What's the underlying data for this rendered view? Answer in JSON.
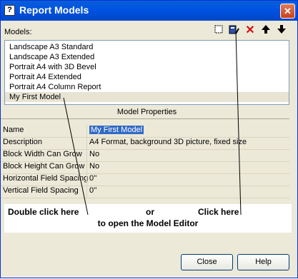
{
  "window": {
    "title": "Report Models",
    "title_icon": "?",
    "close_glyph": "✕"
  },
  "models": {
    "label": "Models:",
    "items": [
      {
        "label": "Landscape A3 Standard"
      },
      {
        "label": "Landscape A3 Extended"
      },
      {
        "label": "Portrait A4 with 3D Bevel"
      },
      {
        "label": "Portrait A4 Extended"
      },
      {
        "label": "Portrait A4 Column Report"
      },
      {
        "label": "My First Model",
        "selected": true
      }
    ]
  },
  "toolbar": {
    "new_icon": "new-icon",
    "edit_icon": "edit-model-icon",
    "delete_icon": "delete-icon",
    "up_icon": "arrow-up-icon",
    "down_icon": "arrow-down-icon"
  },
  "properties": {
    "header": "Model Properties",
    "rows": [
      {
        "name": "Name",
        "value": "My First Model"
      },
      {
        "name": "Description",
        "value": "A4 Format, background 3D picture, fixed size"
      },
      {
        "name": "Block Width Can Grow",
        "value": "No"
      },
      {
        "name": "Block Height Can Grow",
        "value": "No"
      },
      {
        "name": "Horizontal Field Spacing",
        "value": "0''"
      },
      {
        "name": "Vertical Field Spacing",
        "value": "0''"
      }
    ]
  },
  "annotation": {
    "left": "Double click here",
    "middle": "or",
    "right": "Click here",
    "bottom": "to open the Model Editor"
  },
  "buttons": {
    "close": "Close",
    "help": "Help"
  }
}
